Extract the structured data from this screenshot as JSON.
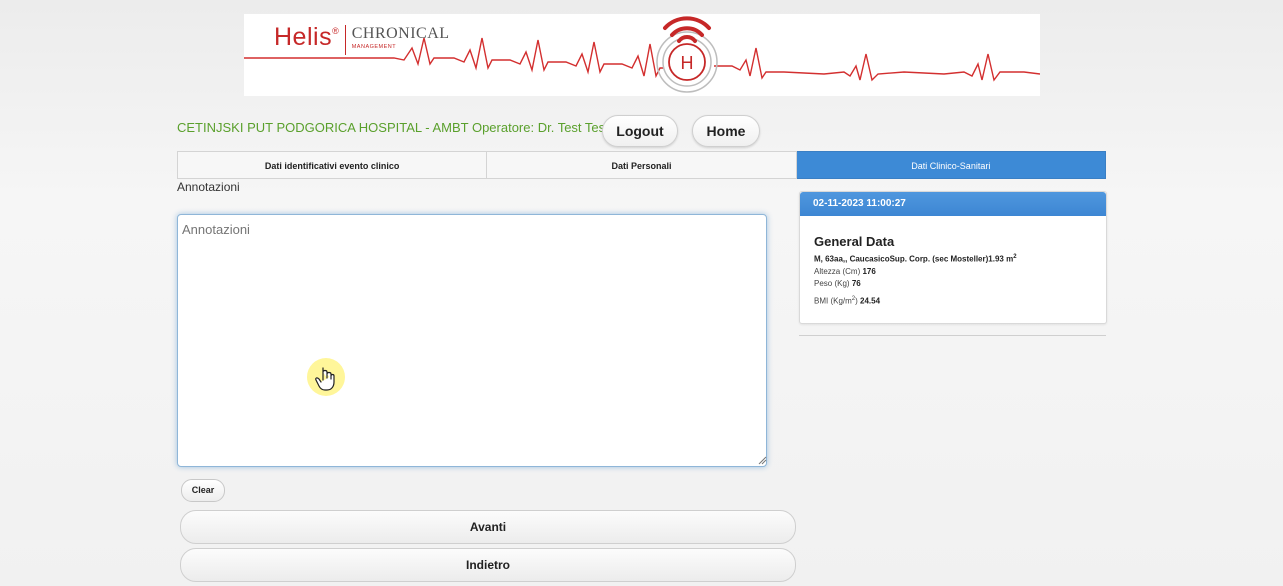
{
  "header": {
    "logo_brand": "Helis",
    "logo_product": "CHRONICAL",
    "logo_tagline": "MANAGEMENT",
    "hospital_text": "CETINJSKI PUT PODGORICA HOSPITAL - AMBT  Operatore: Dr. Test Test",
    "logout_label": "Logout",
    "home_label": "Home"
  },
  "tabs": [
    {
      "label": "Dati identificativi evento clinico",
      "active": false
    },
    {
      "label": "Dati Personali",
      "active": false
    },
    {
      "label": "Dati Clinico-Sanitari",
      "active": true
    }
  ],
  "annotations": {
    "label": "Annotazioni",
    "placeholder": "Annotazioni",
    "value": "",
    "clear_label": "Clear"
  },
  "actions": {
    "next_label": "Avanti",
    "back_label": "Indietro"
  },
  "card": {
    "datetime": "02-11-2023 11:00:27",
    "title": "General Data",
    "summary": "M, 63aa,, CaucasicoSup. Corp. (sec Mosteller)1.93 m",
    "height_label": "Altezza (Cm)",
    "height_value": "176",
    "weight_label": "Peso (Kg)",
    "weight_value": "76",
    "bmi_label_pre": "BMI (Kg/m",
    "bmi_label_post": ")",
    "bmi_value": "24.54"
  },
  "colors": {
    "accent_blue": "#3d8ad6",
    "hospital_green": "#5aa02c",
    "brand_red": "#c62828"
  }
}
